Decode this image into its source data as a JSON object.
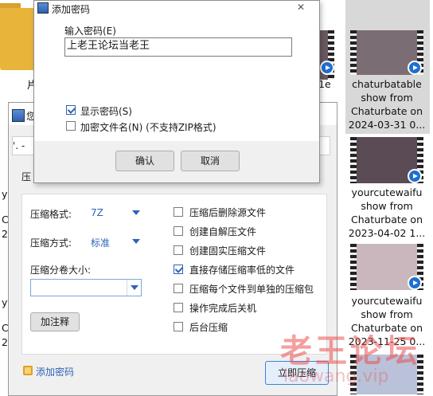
{
  "explorer": {
    "left_partial": [
      "片",
      "y",
      "C",
      "2",
      "y",
      "C",
      "2"
    ],
    "mid_partial": [
      "1e"
    ],
    "files": [
      {
        "lines": [
          "chaturbatable",
          "show from",
          "Chaturbate on",
          "2024-03-31 0..."
        ],
        "selected": true
      },
      {
        "lines": [
          "yourcutewaifu",
          "show from",
          "Chaturbate on",
          "2023-04-02 1..."
        ],
        "selected": false
      },
      {
        "lines": [
          "yourcutewaifu",
          "show from",
          "Chaturbate on",
          "2023-11-25 0..."
        ],
        "selected": false
      }
    ]
  },
  "compress_dialog": {
    "title_partial": "您",
    "path_partial": "'. -",
    "tab_partial": "压",
    "format_label": "压缩格式:",
    "format_value": "7Z",
    "method_label": "压缩方式:",
    "method_value": "标准",
    "volume_label": "压缩分卷大小:",
    "volume_value": "",
    "comment_button": "加注释",
    "options": [
      {
        "label": "压缩后删除源文件",
        "checked": false
      },
      {
        "label": "创建自解压文件",
        "checked": false
      },
      {
        "label": "创建固实压缩文件",
        "checked": false
      },
      {
        "label": "直接存储压缩率低的文件",
        "checked": true
      },
      {
        "label": "压缩每个文件到单独的压缩包",
        "checked": false
      },
      {
        "label": "操作完成后关机",
        "checked": false
      },
      {
        "label": "后台压缩",
        "checked": false
      }
    ],
    "add_password_link": "添加密码",
    "start_button": "立即压缩"
  },
  "password_dialog": {
    "title": "添加密码",
    "close_glyph": "✕",
    "field_label": "输入密码(E)",
    "password_value": "上老王论坛当老王",
    "show_password": {
      "label": "显示密码(S)",
      "checked": true
    },
    "encrypt_names": {
      "label": "加密文件名(N) (不支持ZIP格式)",
      "checked": false
    },
    "ok_button": "确认",
    "cancel_button": "取消"
  },
  "watermark": {
    "text": "老王论坛",
    "sub": "laowang.vip"
  },
  "colors": {
    "accent": "#2f63b8",
    "link": "#2f63b8",
    "watermark": "#eb5050"
  }
}
